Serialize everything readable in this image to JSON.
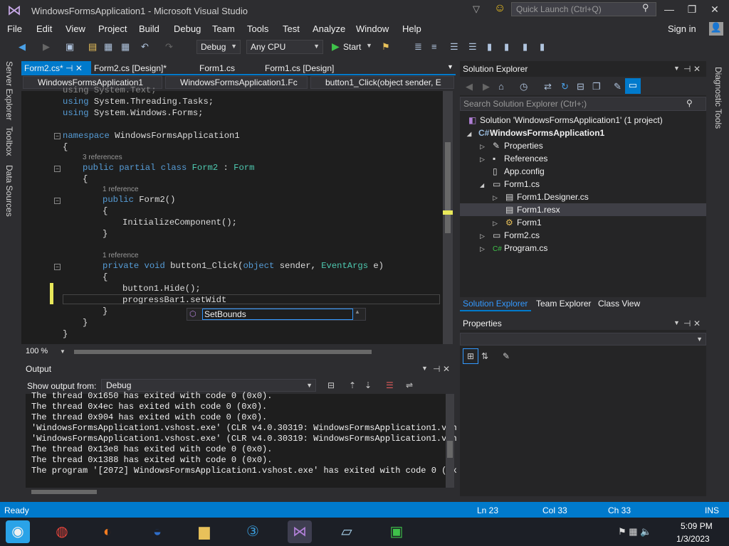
{
  "window": {
    "title": "WindowsFormsApplication1 - Microsoft Visual Studio",
    "quick_launch_placeholder": "Quick Launch (Ctrl+Q)"
  },
  "menu": [
    "File",
    "Edit",
    "View",
    "Project",
    "Build",
    "Debug",
    "Team",
    "Tools",
    "Test",
    "Analyze",
    "Window",
    "Help"
  ],
  "signin": "Sign in",
  "toolbar": {
    "config": "Debug",
    "platform": "Any CPU",
    "start": "Start"
  },
  "left_tabs": [
    "Server Explorer",
    "Toolbox",
    "Data Sources"
  ],
  "right_tabs": [
    "Diagnostic Tools"
  ],
  "editor_tabs": [
    "Form2.cs*",
    "Form2.cs [Design]*",
    "Form1.cs",
    "Form1.cs [Design]"
  ],
  "nav": {
    "project": "WindowsFormsApplication1",
    "type": "WindowsFormsApplication1.Fc",
    "member": "button1_Click(object sender, E"
  },
  "code": {
    "using1": "using System.Text;",
    "using2": "using System.Threading.Tasks;",
    "using3": "using System.Windows.Forms;",
    "ns_kw": "namespace",
    "ns_name": " WindowsFormsApplication1",
    "brace_open": "{",
    "brace_close": "}",
    "refs3": "3 references",
    "class_kw": "public partial class",
    "class_name": "Form2",
    "class_base_sep": " : ",
    "class_base": "Form",
    "refs1": "1 reference",
    "ctor_kw": "public",
    "ctor_name": " Form2()",
    "init": "InitializeComponent();",
    "method_kw": "private void",
    "method_name": " button1_Click(",
    "param1_kw": "object",
    "param1_name": " sender, ",
    "param2_type": "EventArgs",
    "param2_name": " e)",
    "hide": "button1.Hide();",
    "progress": "progressBar1.setWidt"
  },
  "autocomplete": "SetBounds",
  "zoom": "100 %",
  "output": {
    "title": "Output",
    "show_from_label": "Show output from:",
    "show_from_value": "Debug",
    "lines": [
      "The thread 0x1650 has exited with code 0 (0x0).",
      "The thread 0x4ec has exited with code 0 (0x0).",
      "The thread 0x904 has exited with code 0 (0x0).",
      "'WindowsFormsApplication1.vshost.exe' (CLR v4.0.30319: WindowsFormsApplication1.vsh",
      "'WindowsFormsApplication1.vshost.exe' (CLR v4.0.30319: WindowsFormsApplication1.vsh",
      "The thread 0x13e8 has exited with code 0 (0x0).",
      "The thread 0x1388 has exited with code 0 (0x0).",
      "The program '[2072] WindowsFormsApplication1.vshost.exe' has exited with code 0 (0x"
    ]
  },
  "solution_explorer": {
    "title": "Solution Explorer",
    "search_placeholder": "Search Solution Explorer (Ctrl+;)",
    "tree": [
      "Solution 'WindowsFormsApplication1' (1 project)",
      "WindowsFormsApplication1",
      "Properties",
      "References",
      "App.config",
      "Form1.cs",
      "Form1.Designer.cs",
      "Form1.resx",
      "Form1",
      "Form2.cs",
      "Program.cs"
    ],
    "tabs": [
      "Solution Explorer",
      "Team Explorer",
      "Class View"
    ]
  },
  "properties": {
    "title": "Properties"
  },
  "status": {
    "ready": "Ready",
    "ln": "Ln 23",
    "col": "Col 33",
    "ch": "Ch 33",
    "ins": "INS"
  },
  "clock": {
    "time": "5:09 PM",
    "date": "1/3/2023"
  },
  "colors": {
    "accent": "#007acc",
    "keyword": "#569cd6",
    "type": "#4ec9b0"
  }
}
